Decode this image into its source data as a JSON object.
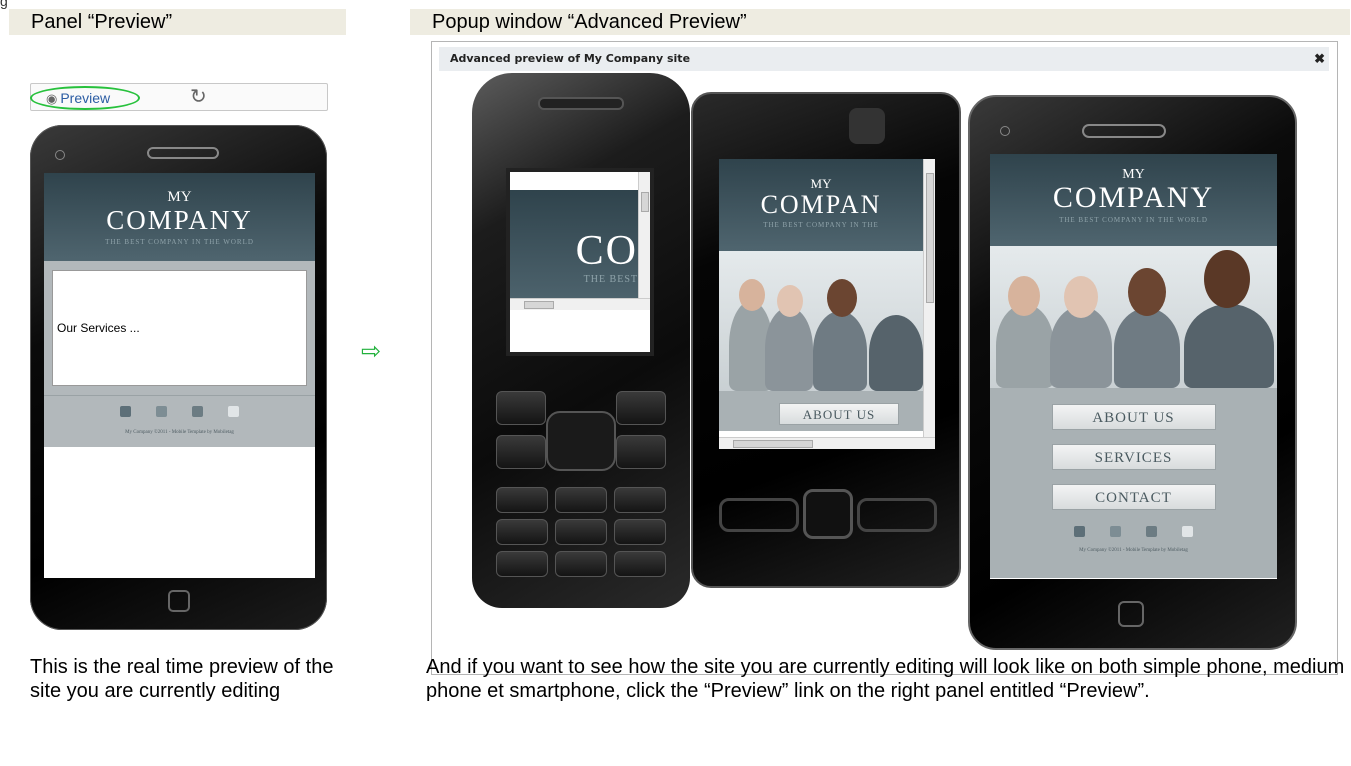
{
  "top_hint": "g",
  "left_panel": {
    "header": "Panel “Preview”",
    "preview_label": "Preview",
    "icons": {
      "eye": "eye-icon",
      "refresh": "refresh-icon"
    }
  },
  "site": {
    "my": "MY",
    "company": "COMPANY",
    "tagline": "THE BEST COMPANY IN THE WORLD",
    "content_text": "Our Services ...",
    "footer": "My Company ©2011 - Mobile Template by Mobiletag",
    "menu": [
      "ABOUT US",
      "SERVICES",
      "CONTACT"
    ],
    "crop_a_company": "CO",
    "crop_a_tagline": "THE BEST",
    "crop_b_company": "COMPAN",
    "crop_b_tagline": "THE BEST COMPANY IN THE",
    "crop_b_about": "ABOUT US"
  },
  "arrow": "⇨",
  "popup": {
    "header": "Popup window “Advanced Preview”",
    "title": "Advanced preview of My Company site",
    "close": "✖"
  },
  "captions": {
    "left": "This is the real time preview of the site you are currently editing",
    "right": "And if you want to see how the site you are currently editing will look like on both simple phone, medium phone et smartphone, click the “Preview” link on the right panel entitled “Preview”."
  },
  "colors": {
    "highlight_green": "#27c13c",
    "header_bg": "#eeece1",
    "site_header": "#3a4f58"
  }
}
